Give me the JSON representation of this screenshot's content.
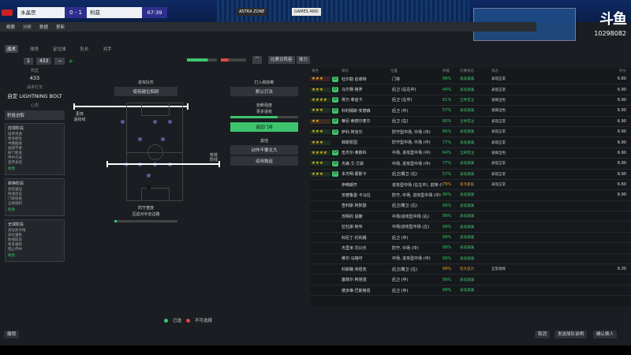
{
  "scoreboard": {
    "home_team": "水晶宫",
    "score": "0 - 1",
    "away_team": "利兹",
    "time": "67:39",
    "ads": [
      "ASTRA ZONE",
      "GAMES AND"
    ]
  },
  "watermark": {
    "logo": "斗鱼",
    "room_id": "10298082"
  },
  "toolbar": {
    "items": [
      "概要",
      "分析",
      "数据",
      "更新"
    ]
  },
  "tabs": [
    "战术",
    "球员",
    "定位球",
    "队长",
    "对手"
  ],
  "control": {
    "formation": "433",
    "minus": "−",
    "plus": "+",
    "match_label": "比赛日阵容",
    "mode": "体力"
  },
  "left_panel": {
    "formation_label": "阵型",
    "formation_value": "433",
    "style_label": "战术打法",
    "style_value": "自定 LIGHTNING BOLT",
    "mentality_label": "心态",
    "mentality_value": "积极进取",
    "card1": {
      "title": "控球阶段",
      "items": [
        "短传渗透",
        "更多配合",
        "中路推进",
        "加快节奏",
        "射门机会",
        "传中方式",
        "直传身后"
      ],
      "btn": "修改"
    },
    "card2": {
      "title": "转换阶段",
      "items": [
        "反抢逼迫",
        "快速反击",
        "门将快发",
        "立即组织"
      ],
      "btn": "修改"
    },
    "card3": {
      "title": "无球阶段",
      "items": [
        "高位防守线",
        "高位逼抢",
        "防线前压",
        "更多逼抢",
        "阻止传中"
      ],
      "btn": "修改"
    }
  },
  "pitch": {
    "attack_zone": "进攻队形",
    "attack_value": "使用越位陷阱",
    "engage_label": "更高",
    "engage_sub": "逼抢线",
    "defense_label": "较低",
    "defense_sub": "防线",
    "def_title": "防守宽度",
    "def_value": "压迫对手走边路",
    "right_title": "打入和抢断",
    "right_value": "默认打法",
    "tackle_title": "抢断强度",
    "tackle_value": "更多逼抢",
    "tackle_btn": "逼迫门将",
    "other_title": "其他",
    "other_value1": "动作不要太大",
    "other_value2": "运用拖延"
  },
  "legend": {
    "selected": "已选",
    "unavailable": "不可选择"
  },
  "table": {
    "headers": [
      "角色",
      "",
      "球员",
      "位置",
      "体能",
      "比赛状态",
      "状态",
      "备注",
      "评分"
    ],
    "rows": [
      {
        "stars": "★★★",
        "badge": "D",
        "name": "杜尔勒 伯菲特",
        "pos": "门将",
        "fit": "99%",
        "stat": "表现满满",
        "note": "表现正常",
        "rating": "6.80",
        "color": "#3ec46d"
      },
      {
        "stars": "★★★",
        "badge": "D",
        "name": "马尔赛·格罗",
        "pos": "后卫 (右右中)",
        "fit": "44%",
        "stat": "表现满满",
        "note": "表现正常",
        "rating": "6.90",
        "color": "#3ec46d"
      },
      {
        "stars": "★★★★",
        "badge": "D",
        "name": "埃万·菲迪卡",
        "pos": "后卫 (左中)",
        "fit": "61%",
        "stat": "全神贯注",
        "note": "发挥出色",
        "rating": "6.90",
        "color": "#3ec46d"
      },
      {
        "stars": "★★★",
        "badge": "D",
        "name": "科利姆斯·安德森",
        "pos": "后卫 (中)",
        "fit": "57%",
        "stat": "表现满满",
        "note": "发挥出色",
        "rating": "6.90",
        "color": "#3ec46d"
      },
      {
        "stars": "★★",
        "badge": "D",
        "name": "蒂尼·索德尔麦尔",
        "pos": "后卫 (右)",
        "fit": "60%",
        "stat": "全神贯注",
        "note": "表现正常",
        "rating": "6.90",
        "color": "#3ec46d"
      },
      {
        "stars": "★★★",
        "badge": "D",
        "name": "萨科·阿克尔",
        "pos": "防守型中场, 中场 (中)",
        "fit": "66%",
        "stat": "表现满满",
        "note": "表现正常",
        "rating": "6.90",
        "color": "#3ec46d"
      },
      {
        "stars": "★★★",
        "badge": "",
        "name": "菲斯凯因",
        "pos": "防守型中场, 中场 (中)",
        "fit": "77%",
        "stat": "表现满满",
        "note": "表现正常",
        "rating": "6.90",
        "color": "#3ec46d"
      },
      {
        "stars": "★★★★",
        "badge": "D",
        "name": "伍杰尔·奥斯科",
        "pos": "中场, 进攻型中场 (中)",
        "fit": "64%",
        "stat": "全神贯注",
        "note": "发挥出色",
        "rating": "6.90",
        "color": "#3ec46d"
      },
      {
        "stars": "★★★",
        "badge": "D",
        "name": "杰森·艾·艾斯",
        "pos": "中场, 进攻型中场 (中)",
        "fit": "77%",
        "stat": "表现满满",
        "note": "表现正常",
        "rating": "6.90",
        "color": "#3ec46d"
      },
      {
        "stars": "★★★",
        "badge": "D",
        "name": "本杰明·霍斯卡",
        "pos": "后卫/翼卫 (右)",
        "fit": "57%",
        "stat": "表现满满",
        "note": "表现正常",
        "rating": "6.90",
        "color": "#3ec46d"
      },
      {
        "stars": "",
        "badge": "",
        "name": "伊弗朗齐",
        "pos": "进攻型中场 (右左中), 前锋 (中)",
        "fit": "79%",
        "stat": "有点紧张",
        "note": "表现正常",
        "rating": "6.60",
        "color": "#e0a030"
      },
      {
        "stars": "",
        "badge": "",
        "name": "安德鲁曼·卡马拉",
        "pos": "防守, 中场, 进攻型中场 (中)",
        "fit": "99%",
        "stat": "表现满满",
        "note": "",
        "rating": "6.90",
        "color": "#3ec46d"
      },
      {
        "stars": "",
        "badge": "",
        "name": "查利斯·阿默瑟",
        "pos": "后卫/翼卫 (右)",
        "fit": "99%",
        "stat": "表现满满",
        "note": "",
        "rating": "",
        "color": "#3ec46d"
      },
      {
        "stars": "",
        "badge": "",
        "name": "苏明的 鼠瞭",
        "pos": "中场/进攻型中场 (右)",
        "fit": "99%",
        "stat": "表现满满",
        "note": "",
        "rating": "",
        "color": "#3ec46d"
      },
      {
        "stars": "",
        "badge": "",
        "name": "拉杜斯·阿布",
        "pos": "中场/进攻型中场 (左)",
        "fit": "99%",
        "stat": "表现满满",
        "note": "",
        "rating": "",
        "color": "#3ec46d"
      },
      {
        "stars": "",
        "badge": "",
        "name": "科尼丁·托利姆",
        "pos": "后卫 (中)",
        "fit": "99%",
        "stat": "表现满满",
        "note": "",
        "rating": "",
        "color": "#3ec46d"
      },
      {
        "stars": "",
        "badge": "",
        "name": "杰里米·华兴乐",
        "pos": "防守, 中场 (中)",
        "fit": "99%",
        "stat": "表现满满",
        "note": "",
        "rating": "",
        "color": "#3ec46d"
      },
      {
        "stars": "",
        "badge": "",
        "name": "维尔·马瑞可",
        "pos": "中场, 进攻型中场 (中)",
        "fit": "99%",
        "stat": "表现满满",
        "note": "",
        "rating": "",
        "color": "#3ec46d"
      },
      {
        "stars": "",
        "badge": "",
        "name": "科斯路·米纽克",
        "pos": "后卫/翼卫 (左)",
        "fit": "99%",
        "stat": "较大压力",
        "note": "正常发挥",
        "rating": "6.30",
        "color": "#e0a030"
      },
      {
        "stars": "",
        "badge": "",
        "name": "塞菲尔·阿塔诺",
        "pos": "后卫 (中)",
        "fit": "99%",
        "stat": "表现满满",
        "note": "",
        "rating": "",
        "color": "#3ec46d"
      },
      {
        "stars": "",
        "badge": "",
        "name": "德多琳·巴斯格恩",
        "pos": "后卫 (中)",
        "fit": "99%",
        "stat": "表现满满",
        "note": "",
        "rating": "",
        "color": "#3ec46d"
      }
    ]
  },
  "bottom": {
    "back": "撤销",
    "cancel": "取消",
    "send": "发送球队说明",
    "confirm": "确认换人"
  }
}
